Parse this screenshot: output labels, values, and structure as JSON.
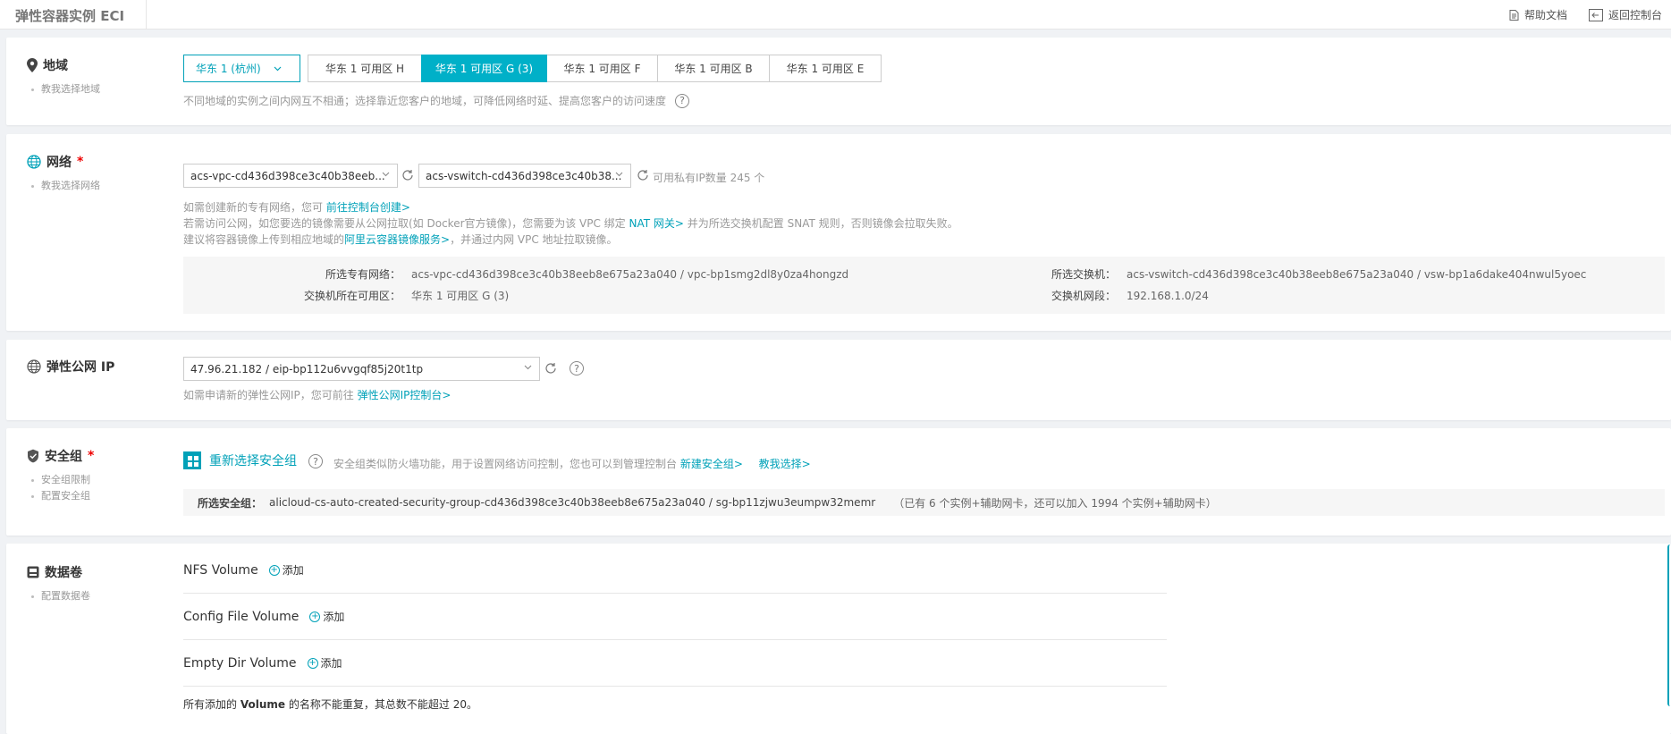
{
  "header": {
    "title": "弹性容器实例 ECI",
    "help_label": "帮助文档",
    "console_label": "返回控制台"
  },
  "region": {
    "title": "地域",
    "subs": [
      "教我选择地域"
    ],
    "selected_region": "华东 1 (杭州)",
    "zones": [
      "华东 1 可用区 H",
      "华东 1 可用区 G (3)",
      "华东 1 可用区 F",
      "华东 1 可用区 B",
      "华东 1 可用区 E"
    ],
    "active_zone": "华东 1 可用区 G (3)",
    "hint": "不同地域的实例之间内网互不相通；选择靠近您客户的地域，可降低网络时延、提高您客户的访问速度"
  },
  "network": {
    "title": "网络",
    "required": "*",
    "subs": [
      "教我选择网络"
    ],
    "vpc_select": "acs-vpc-cd436d398ce3c40b38eeb...",
    "vswitch_select": "acs-vswitch-cd436d398ce3c40b38...",
    "ip_available": "可用私有IP数量 245 个",
    "line1_pre": "如需创建新的专有网络，您可",
    "line1_link": "前往控制台创建>",
    "line2_pre": "若需访问公网，如您要选的镜像需要从公网拉取(如 Docker官方镜像)，您需要为该 VPC 绑定",
    "line2_link": "NAT 网关>",
    "line2_post": "并为所选交换机配置 SNAT 规则，否则镜像会拉取失败。",
    "line3_pre": "建议将容器镜像上传到相应地域的",
    "line3_link": "阿里云容器镜像服务>",
    "line3_post": "，并通过内网 VPC 地址拉取镜像。",
    "vpc_label": "所选专有网络：",
    "vpc_value": "acs-vpc-cd436d398ce3c40b38eeb8e675a23a040 / vpc-bp1smg2dl8y0za4hongzd",
    "zone_label": "交换机所在可用区：",
    "zone_value": "华东 1 可用区 G (3)",
    "vswitch_label": "所选交换机：",
    "vswitch_value": "acs-vswitch-cd436d398ce3c40b38eeb8e675a23a040 / vsw-bp1a6dake404nwul5yoec",
    "cidr_label": "交换机网段：",
    "cidr_value": "192.168.1.0/24"
  },
  "eip": {
    "title": "弹性公网 IP",
    "select_value": "47.96.21.182 / eip-bp112u6vvgqf85j20t1tp",
    "hint_pre": "如需申请新的弹性公网IP，您可前往",
    "hint_link": "弹性公网IP控制台>"
  },
  "security": {
    "title": "安全组",
    "required": "*",
    "subs": [
      "安全组限制",
      "配置安全组"
    ],
    "reselect_label": "重新选择安全组",
    "desc": "安全组类似防火墙功能，用于设置网络访问控制，您也可以到管理控制台",
    "new_link": "新建安全组>",
    "teach_link": "教我选择>",
    "selected_label": "所选安全组：",
    "selected_value": "alicloud-cs-auto-created-security-group-cd436d398ce3c40b38eeb8e675a23a040 / sg-bp11zjwu3eumpw32memr",
    "capacity": "（已有 6 个实例+辅助网卡，还可以加入 1994 个实例+辅助网卡）"
  },
  "volumes": {
    "title": "数据卷",
    "subs": [
      "配置数据卷"
    ],
    "items": [
      {
        "name": "NFS Volume",
        "add": "添加"
      },
      {
        "name": "Config File Volume",
        "add": "添加"
      },
      {
        "name": "Empty Dir Volume",
        "add": "添加"
      }
    ],
    "note_pre": "所有添加的",
    "note_bold": "Volume",
    "note_mid": "的名称不能重复",
    "note_post": "，其总数不能超过 20。"
  },
  "colors": {
    "accent": "#00a1b8",
    "active_zone": "#00b0c8",
    "required": "#e00000"
  }
}
